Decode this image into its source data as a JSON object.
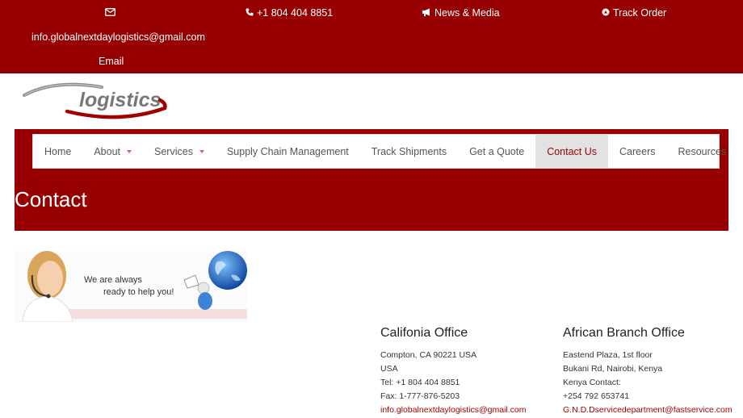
{
  "topbar": {
    "email_icon": "envelope-icon",
    "email_address": "info.globalnextdaylogistics@gmail.com",
    "email_label": "Email",
    "phone_icon": "phone-icon",
    "phone": "+1 804 404 8851",
    "news_icon": "bullhorn-icon",
    "news": "News & Media",
    "track_icon": "arrow-circle-icon",
    "track": "Track Order"
  },
  "logo": {
    "text": "logistics"
  },
  "nav": {
    "items": [
      {
        "label": "Home"
      },
      {
        "label": "About"
      },
      {
        "label": "Services"
      },
      {
        "label": "Supply Chain Management"
      },
      {
        "label": "Track Shipments"
      },
      {
        "label": "Get a Quote"
      },
      {
        "label": "Contact Us"
      },
      {
        "label": "Careers"
      },
      {
        "label": "Resources"
      }
    ]
  },
  "page_title": "Contact",
  "banner": {
    "line1": "We are always",
    "line2": "ready to help you!"
  },
  "offices": {
    "california": {
      "title": "Califonia Office",
      "lines": [
        "Compton, CA 90221 USA",
        "USA",
        "Tel: +1 804 404 8851",
        "Fax: 1-777-876-5203"
      ],
      "email": "info.globalnextdaylogistics@gmail.com"
    },
    "africa": {
      "title": "African Branch Office",
      "lines": [
        "Eastend Plaza, 1st floor",
        "Bukani Rd, Nairobi, Kenya",
        "Kenya Contact:",
        "+254 792 653741"
      ],
      "email": "G.N.D.Dservicedepartment@fastservice.com"
    }
  },
  "colors": {
    "brand": "#960000",
    "active_nav_bg": "#e2e2e2",
    "link": "#a80000"
  }
}
